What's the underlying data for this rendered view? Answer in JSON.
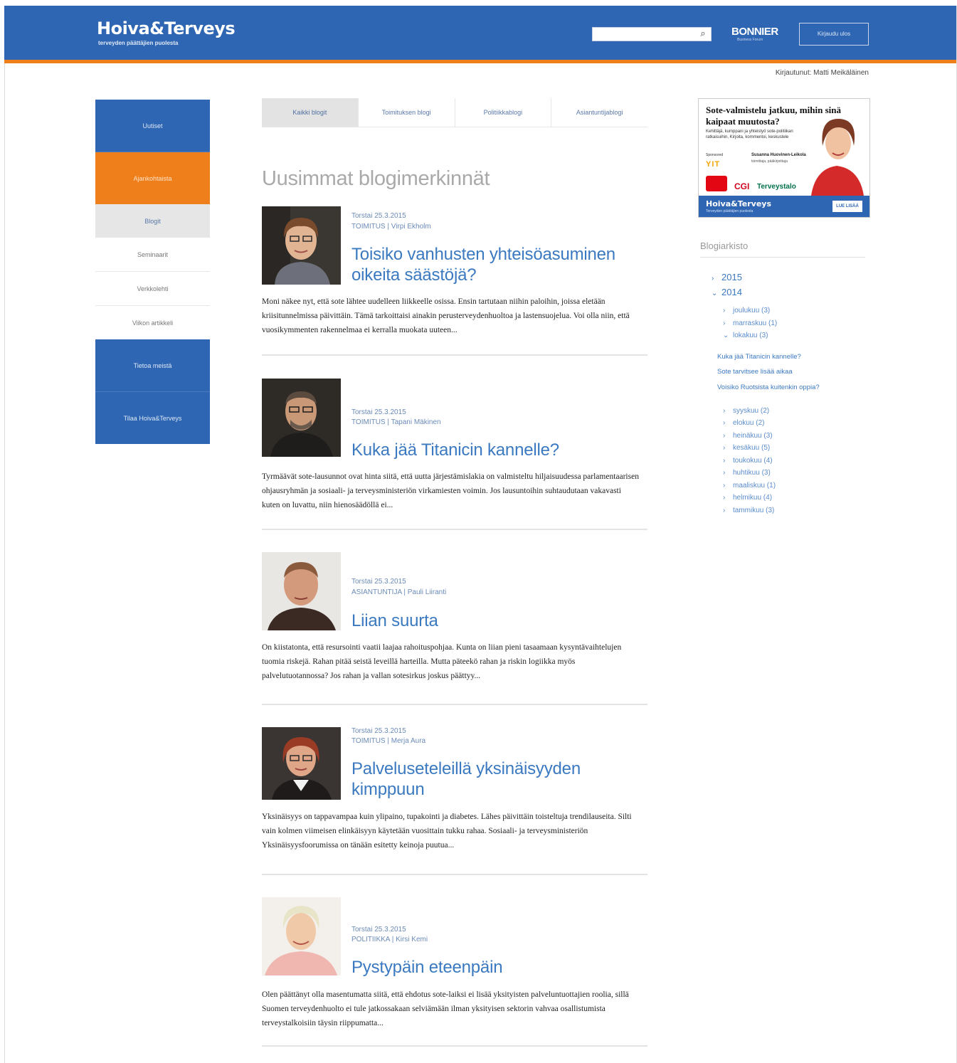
{
  "header": {
    "logo": "Hoiva&Terveys",
    "logo_sub": "terveyden päättäjien puolesta",
    "search_placeholder": "",
    "partner": "BONNIER",
    "partner_sub": "Business Forum",
    "logout_label": "Kirjaudu ulos",
    "logged_in": "Kirjautunut: Matti Meikäläinen"
  },
  "sidebar": {
    "items": [
      {
        "label": "Uutiset"
      },
      {
        "label": "Ajankohtaista"
      },
      {
        "label": "Blogit"
      },
      {
        "label": "Seminaarit"
      },
      {
        "label": "Verkkolehti"
      },
      {
        "label": "Viikon artikkeli"
      },
      {
        "label": "Tietoa meistä"
      },
      {
        "label": "Tilaa Hoiva&Terveys"
      }
    ]
  },
  "tabs": [
    {
      "label": "Kaikki blogit"
    },
    {
      "label": "Toimituksen blogi"
    },
    {
      "label": "Politiikkablogi"
    },
    {
      "label": "Asiantuntijablogi"
    }
  ],
  "page_title": "Uusimmat blogimerkinnät",
  "posts": [
    {
      "date": "Torstai 25.3.2015",
      "category": "TOIMITUS | Virpi Ekholm",
      "title": "Toisiko vanhusten yhteisöasuminen oikeita säästöjä?",
      "excerpt": "Moni näkee nyt, että sote lähtee uudelleen liikkeelle osissa. Ensin tartutaan niihin paloihin, joissa eletään kriisitunnelmissa päivittäin. Tämä tarkoittaisi ainakin perusterveydenhuoltoa ja lastensuojelua. Voi olla niin, että vuosikymmenten rakennelmaa ei kerralla muokata uuteen..."
    },
    {
      "date": "Torstai 25.3.2015",
      "category": "TOIMITUS | Tapani Mäkinen",
      "title": "Kuka jää Titanicin kannelle?",
      "excerpt": "Tyrmäävät sote-lausunnot ovat hinta siitä, että uutta järjestämislakia on valmisteltu hiljaisuudessa parlamentaarisen ohjausryhmän ja sosiaali- ja terveysministeriön virkamiesten voimin. Jos lausuntoihin suhtaudutaan vakavasti kuten on luvattu, niin hienosäädöllä ei..."
    },
    {
      "date": "Torstai 25.3.2015",
      "category": "ASIANTUNTIJA | Pauli Liiranti",
      "title": "Liian suurta",
      "excerpt": "On kiistatonta, että resursointi vaatii laajaa rahoituspohjaa. Kunta on liian pieni tasaamaan kysyntävaihtelujen tuomia riskejä. Rahan pitää seistä leveillä harteilla. Mutta päteekö rahan ja riskin logiikka myös palvelutuotannossa? Jos rahan ja vallan sotesirkus joskus päättyy..."
    },
    {
      "date": "Torstai 25.3.2015",
      "category": "TOIMITUS | Merja Aura",
      "title": "Palveluseteleillä yksinäisyyden kimppuun",
      "excerpt": "Yksinäisyys on tappavampaa kuin ylipaino, tupakointi ja diabetes. Lähes päivittäin toisteltuja trendilauseita. Silti vain kolmen viimeisen elinkäisyyn käytetään vuosittain tukku rahaa. Sosiaali- ja terveysministeriön Yksinäisyysfoorumissa on tänään esitetty keinoja puutua..."
    },
    {
      "date": "Torstai 25.3.2015",
      "category": "POLITIIKKA | Kirsi Kemi",
      "title": "Pystypäin eteenpäin",
      "excerpt": "Olen päättänyt olla masentumatta siitä, että ehdotus sote-laiksi ei lisää yksityisten palveluntuottajien roolia, sillä Suomen terveydenhuolto ei tule jatkossakaan selviämään ilman yksityisen sektorin vahvaa osallistumista terveystalkoisiin täysin riippumatta..."
    }
  ],
  "ad": {
    "title": "Sote-valmistelu jatkuu, mihin sinä kaipaat muutosta?",
    "small": "Kehittäjä, kumppani ja yhteistyö sote-politiikan ratkaisuihin, Kirjoita, kommentoi, keskustele",
    "sponsor_label": "Sponsored",
    "sponsor": "YIT",
    "speaker": "Susanna Huovinen-Leikola",
    "speaker_role": "toimittaja, pääkirjoittaja",
    "logo_cgi": "CGI",
    "logo_terveys": "Terveystalo",
    "bar_title": "Hoiva&Terveys",
    "bar_sub": "Terveyden päättäjien puolesta",
    "bar_button": "LUE LISÄÄ"
  },
  "archive": {
    "heading": "Blogiarkisto",
    "years": [
      {
        "label": "2015",
        "expanded": false
      },
      {
        "label": "2014",
        "expanded": true
      }
    ],
    "months_2014_top": [
      "joulukuu (3)",
      "marraskuu (1)",
      "lokakuu (3)"
    ],
    "lokakuu_posts": [
      "Kuka jää Titanicin kannelle?",
      "Sote tarvitsee lisää aikaa",
      "Voisiko Ruotsista kuitenkin oppia?"
    ],
    "months_2014_rest": [
      "syyskuu (2)",
      "elokuu (2)",
      "heinäkuu (3)",
      "kesäkuu (5)",
      "toukokuu (4)",
      "huhtikuu (3)",
      "maaliskuu (1)",
      "helmikuu (4)",
      "tammikuu (3)"
    ]
  },
  "colors": {
    "brand_blue": "#2f66b3",
    "accent_orange": "#ef7f1a",
    "link_blue": "#3b79c0"
  }
}
